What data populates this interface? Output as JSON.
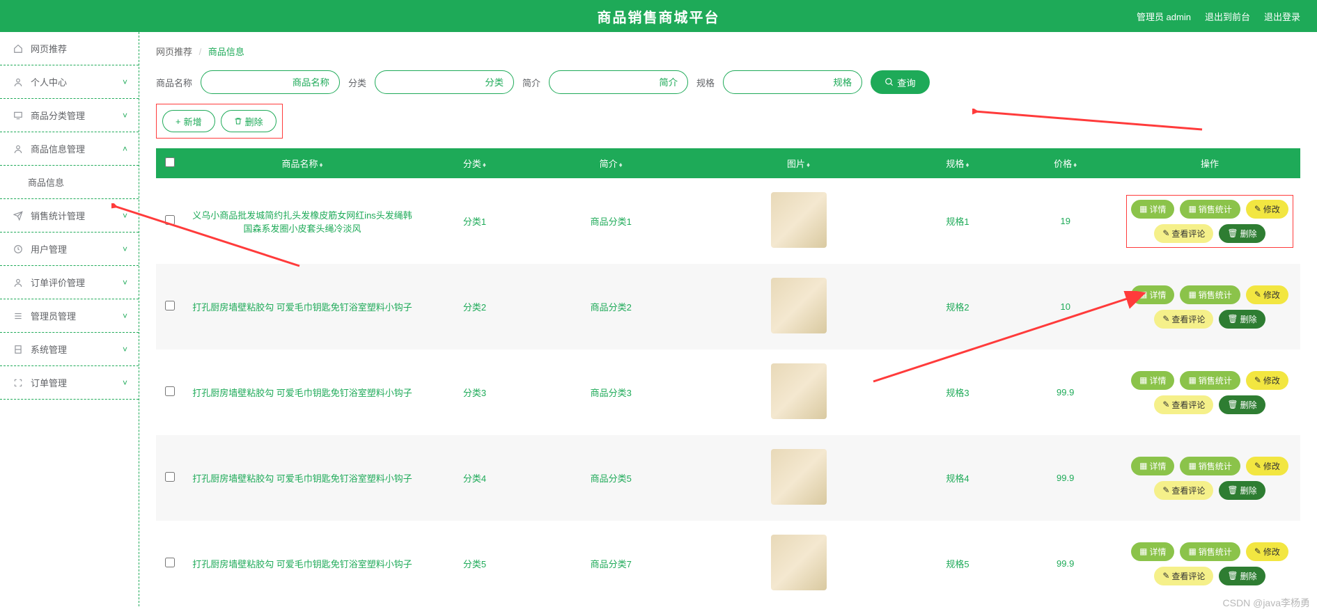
{
  "header": {
    "title": "商品销售商城平台",
    "user_label": "管理员 admin",
    "front_link": "退出到前台",
    "logout": "退出登录"
  },
  "sidebar": {
    "items": [
      {
        "icon": "home",
        "label": "网页推荐",
        "expand": false
      },
      {
        "icon": "user",
        "label": "个人中心",
        "expand": true
      },
      {
        "icon": "monitor",
        "label": "商品分类管理",
        "expand": true
      },
      {
        "icon": "user",
        "label": "商品信息管理",
        "expand": true,
        "open": true,
        "sub": "商品信息"
      },
      {
        "icon": "send",
        "label": "销售统计管理",
        "expand": true
      },
      {
        "icon": "clock",
        "label": "用户管理",
        "expand": true
      },
      {
        "icon": "user",
        "label": "订单评价管理",
        "expand": true
      },
      {
        "icon": "menu",
        "label": "管理员管理",
        "expand": true
      },
      {
        "icon": "cabinet",
        "label": "系统管理",
        "expand": true
      },
      {
        "icon": "scan",
        "label": "订单管理",
        "expand": true
      }
    ]
  },
  "breadcrumb": {
    "root": "网页推荐",
    "current": "商品信息"
  },
  "search": {
    "f1_label": "商品名称",
    "f1_ph": "商品名称",
    "f2_label": "分类",
    "f2_ph": "分类",
    "f3_label": "简介",
    "f3_ph": "简介",
    "f4_label": "规格",
    "f4_ph": "规格",
    "btn": "查询"
  },
  "actions": {
    "add": "新增",
    "del": "删除"
  },
  "table": {
    "cols": [
      "",
      "商品名称",
      "分类",
      "简介",
      "图片",
      "规格",
      "价格",
      "操作"
    ],
    "ops": {
      "detail": "详情",
      "stats": "销售统计",
      "edit": "修改",
      "comments": "查看评论",
      "del": "删除"
    },
    "rows": [
      {
        "name": "义乌小商品批发城简约扎头发橡皮筋女网红ins头发绳韩国森系发圈小皮套头绳冷淡风",
        "cat": "分类1",
        "intro": "商品分类1",
        "spec": "规格1",
        "price": "19"
      },
      {
        "name": "打孔厨房墙壁粘胶勾 可爱毛巾钥匙免钉浴室塑料小钩子",
        "cat": "分类2",
        "intro": "商品分类2",
        "spec": "规格2",
        "price": "10"
      },
      {
        "name": "打孔厨房墙壁粘胶勾 可爱毛巾钥匙免钉浴室塑料小钩子",
        "cat": "分类3",
        "intro": "商品分类3",
        "spec": "规格3",
        "price": "99.9"
      },
      {
        "name": "打孔厨房墙壁粘胶勾 可爱毛巾钥匙免钉浴室塑料小钩子",
        "cat": "分类4",
        "intro": "商品分类5",
        "spec": "规格4",
        "price": "99.9"
      },
      {
        "name": "打孔厨房墙壁粘胶勾 可爱毛巾钥匙免钉浴室塑料小钩子",
        "cat": "分类5",
        "intro": "商品分类7",
        "spec": "规格5",
        "price": "99.9"
      }
    ]
  },
  "watermark": "CSDN @java李杨勇"
}
